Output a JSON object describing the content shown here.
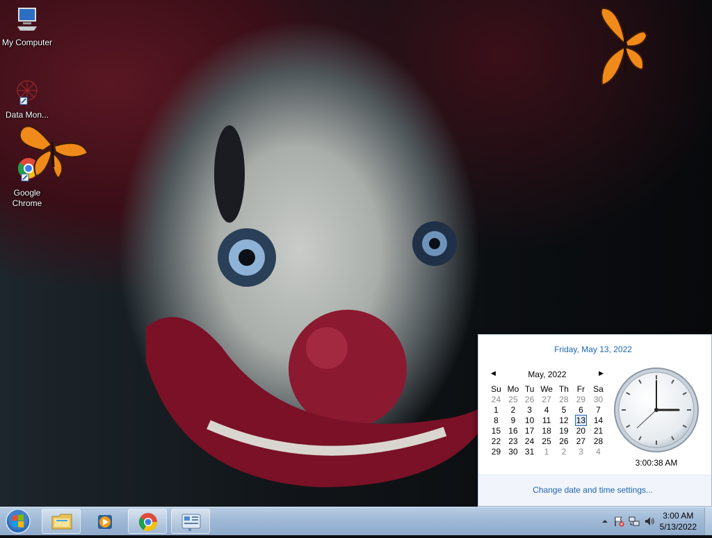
{
  "desktop": {
    "icons": [
      {
        "label": "My Computer"
      },
      {
        "label": "Data Mon..."
      },
      {
        "label": "Google Chrome"
      }
    ]
  },
  "calendar_flyout": {
    "date_title": "Friday, May 13, 2022",
    "month_label": "May, 2022",
    "prev_arrow": "◀",
    "next_arrow": "▶",
    "weekdays": [
      "Su",
      "Mo",
      "Tu",
      "We",
      "Th",
      "Fr",
      "Sa"
    ],
    "weeks": [
      [
        "24",
        "25",
        "26",
        "27",
        "28",
        "29",
        "30"
      ],
      [
        "1",
        "2",
        "3",
        "4",
        "5",
        "6",
        "7"
      ],
      [
        "8",
        "9",
        "10",
        "11",
        "12",
        "13",
        "14"
      ],
      [
        "15",
        "16",
        "17",
        "18",
        "19",
        "20",
        "21"
      ],
      [
        "22",
        "23",
        "24",
        "25",
        "26",
        "27",
        "28"
      ],
      [
        "29",
        "30",
        "31",
        "1",
        "2",
        "3",
        "4"
      ]
    ],
    "selected_day": "13",
    "clock_time": "3:00:38 AM",
    "settings_link": "Change date and time settings..."
  },
  "taskbar": {
    "pinned": [
      {
        "name": "Windows Explorer",
        "icon": "folder-icon"
      },
      {
        "name": "Windows Media Player",
        "icon": "media-player-icon"
      },
      {
        "name": "Google Chrome",
        "icon": "chrome-icon"
      },
      {
        "name": "Control Panel",
        "icon": "control-panel-icon"
      }
    ],
    "tray": {
      "time": "3:00 AM",
      "date": "5/13/2022"
    }
  },
  "colors": {
    "link_blue": "#1e63b3",
    "taskbar": "#9fb9d6",
    "butterfly": "#f08a1a"
  }
}
